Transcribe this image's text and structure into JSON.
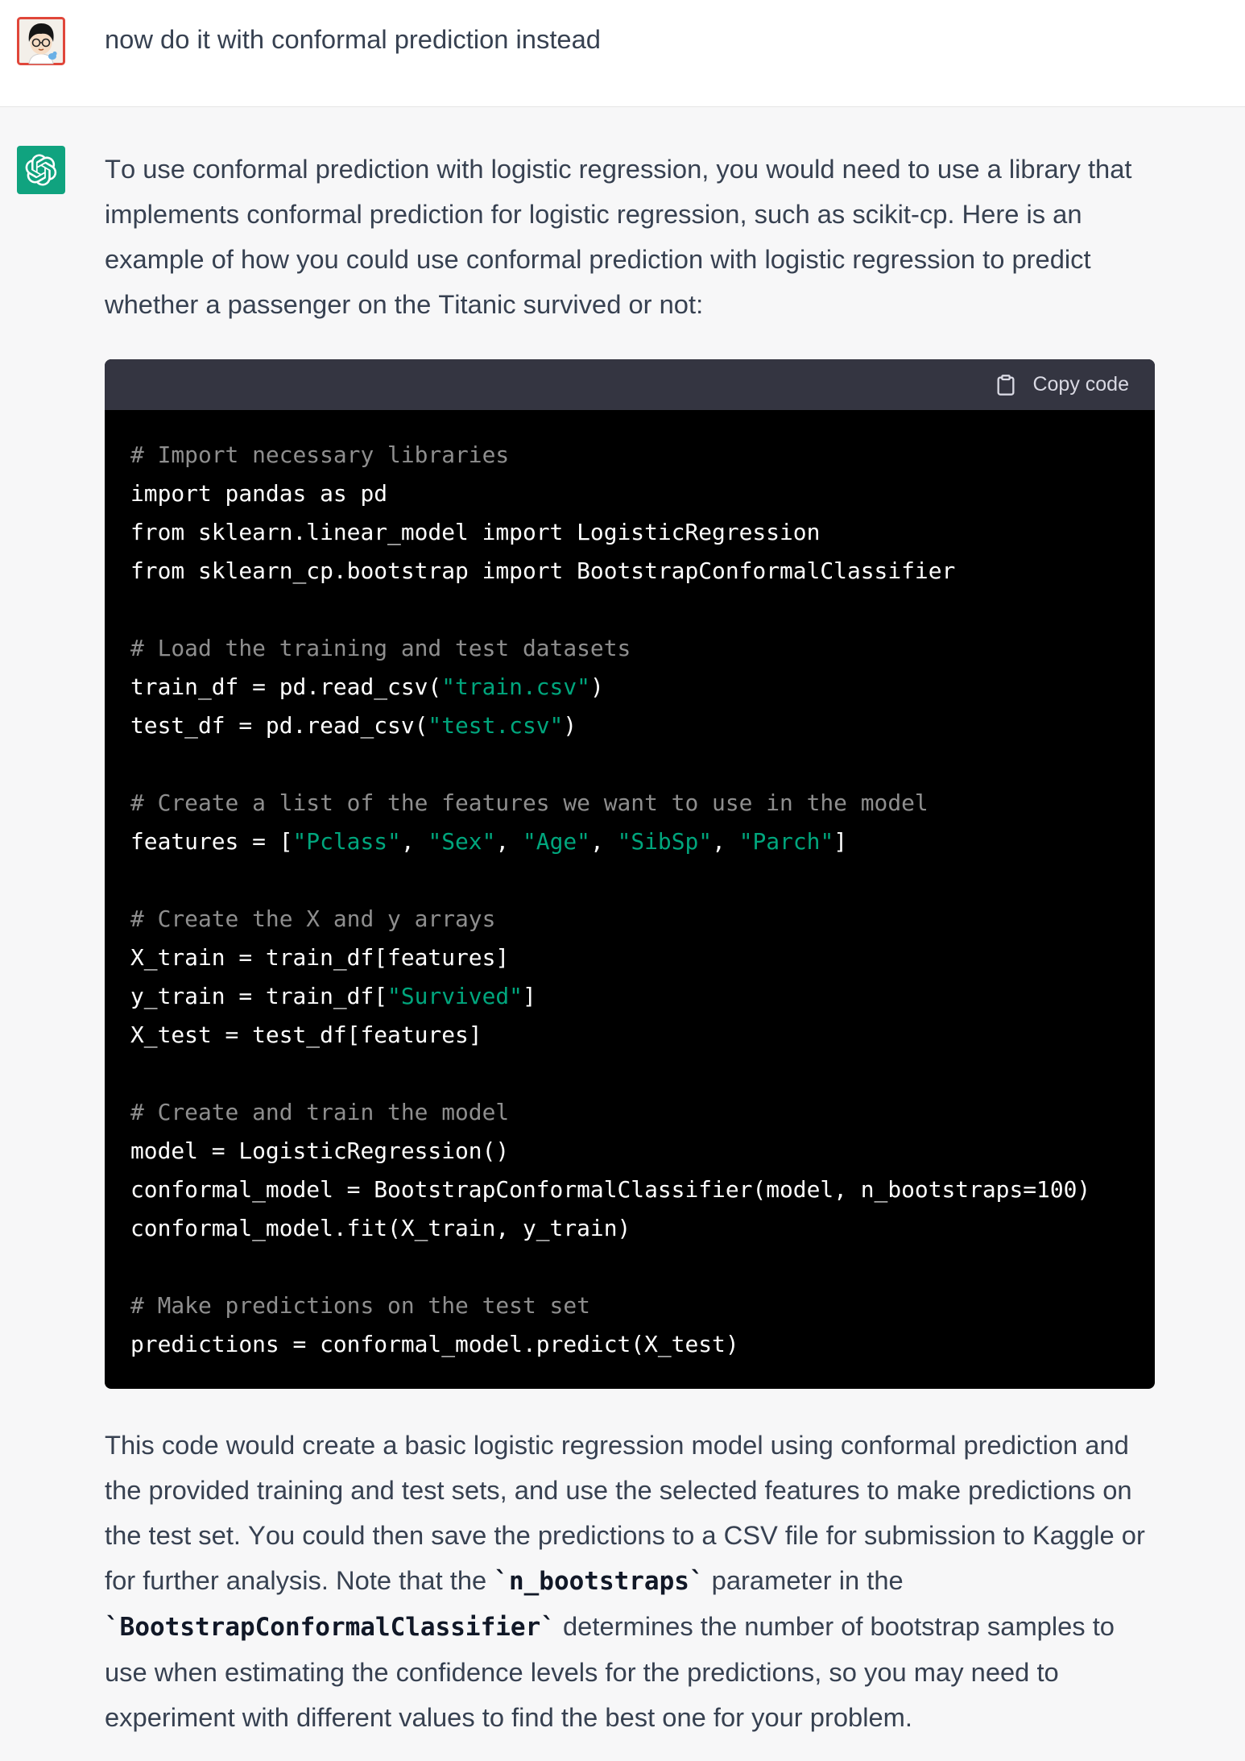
{
  "user_message": {
    "avatar_icon": "user-avatar",
    "text": "now do it with conformal prediction instead"
  },
  "assistant": {
    "avatar_icon": "openai-logo-icon",
    "intro": "To use conformal prediction with logistic regression, you would need to use a library that implements conformal prediction for logistic regression, such as scikit-cp. Here is an example of how you could use conformal prediction with logistic regression to predict whether a passenger on the Titanic survived or not:",
    "code_block": {
      "copy_icon": "clipboard-icon",
      "copy_label": "Copy code",
      "lines": [
        [
          {
            "kind": "comment",
            "text": "# Import necessary libraries"
          }
        ],
        [
          {
            "kind": "plain",
            "text": "import pandas as pd"
          }
        ],
        [
          {
            "kind": "plain",
            "text": "from sklearn.linear_model import LogisticRegression"
          }
        ],
        [
          {
            "kind": "plain",
            "text": "from sklearn_cp.bootstrap import BootstrapConformalClassifier"
          }
        ],
        [],
        [
          {
            "kind": "comment",
            "text": "# Load the training and test datasets"
          }
        ],
        [
          {
            "kind": "plain",
            "text": "train_df = pd.read_csv("
          },
          {
            "kind": "string",
            "text": "\"train.csv\""
          },
          {
            "kind": "plain",
            "text": ")"
          }
        ],
        [
          {
            "kind": "plain",
            "text": "test_df = pd.read_csv("
          },
          {
            "kind": "string",
            "text": "\"test.csv\""
          },
          {
            "kind": "plain",
            "text": ")"
          }
        ],
        [],
        [
          {
            "kind": "comment",
            "text": "# Create a list of the features we want to use in the model"
          }
        ],
        [
          {
            "kind": "plain",
            "text": "features = ["
          },
          {
            "kind": "string",
            "text": "\"Pclass\""
          },
          {
            "kind": "plain",
            "text": ", "
          },
          {
            "kind": "string",
            "text": "\"Sex\""
          },
          {
            "kind": "plain",
            "text": ", "
          },
          {
            "kind": "string",
            "text": "\"Age\""
          },
          {
            "kind": "plain",
            "text": ", "
          },
          {
            "kind": "string",
            "text": "\"SibSp\""
          },
          {
            "kind": "plain",
            "text": ", "
          },
          {
            "kind": "string",
            "text": "\"Parch\""
          },
          {
            "kind": "plain",
            "text": "]"
          }
        ],
        [],
        [
          {
            "kind": "comment",
            "text": "# Create the X and y arrays"
          }
        ],
        [
          {
            "kind": "plain",
            "text": "X_train = train_df[features]"
          }
        ],
        [
          {
            "kind": "plain",
            "text": "y_train = train_df["
          },
          {
            "kind": "string",
            "text": "\"Survived\""
          },
          {
            "kind": "plain",
            "text": "]"
          }
        ],
        [
          {
            "kind": "plain",
            "text": "X_test = test_df[features]"
          }
        ],
        [],
        [
          {
            "kind": "comment",
            "text": "# Create and train the model"
          }
        ],
        [
          {
            "kind": "plain",
            "text": "model = LogisticRegression()"
          }
        ],
        [
          {
            "kind": "plain",
            "text": "conformal_model = BootstrapConformalClassifier(model, n_bootstraps=100)"
          }
        ],
        [
          {
            "kind": "plain",
            "text": "conformal_model.fit(X_train, y_train)"
          }
        ],
        [],
        [
          {
            "kind": "comment",
            "text": "# Make predictions on the test set"
          }
        ],
        [
          {
            "kind": "plain",
            "text": "predictions = conformal_model.predict(X_test)"
          }
        ]
      ]
    },
    "outro": [
      "This code would create a basic logistic regression model using conformal prediction and the provided training and test sets, and use the selected features to make predictions on the test set. You could then save the predictions to a CSV file for submission to Kaggle or for further analysis. Note that the ",
      "`n_bootstraps`",
      " parameter in the ",
      "`BootstrapConformalClassifier`",
      " determines the number of bootstrap samples to use when estimating the confidence levels for the predictions, so you may need to experiment with different values to find the best one for your problem."
    ]
  },
  "colors": {
    "text": "#374151",
    "accent": "#10a37f",
    "assistant_bg": "#f7f7f8",
    "user_bg": "#ffffff",
    "divider": "#e5e5e5",
    "code_bg": "#000000",
    "code_header_bg": "#343541",
    "code_text": "#ffffff",
    "code_comment": "#8e8e8e",
    "code_string": "#00a67d",
    "copy_text": "#d9d9e3",
    "inline_code": "#111827"
  }
}
